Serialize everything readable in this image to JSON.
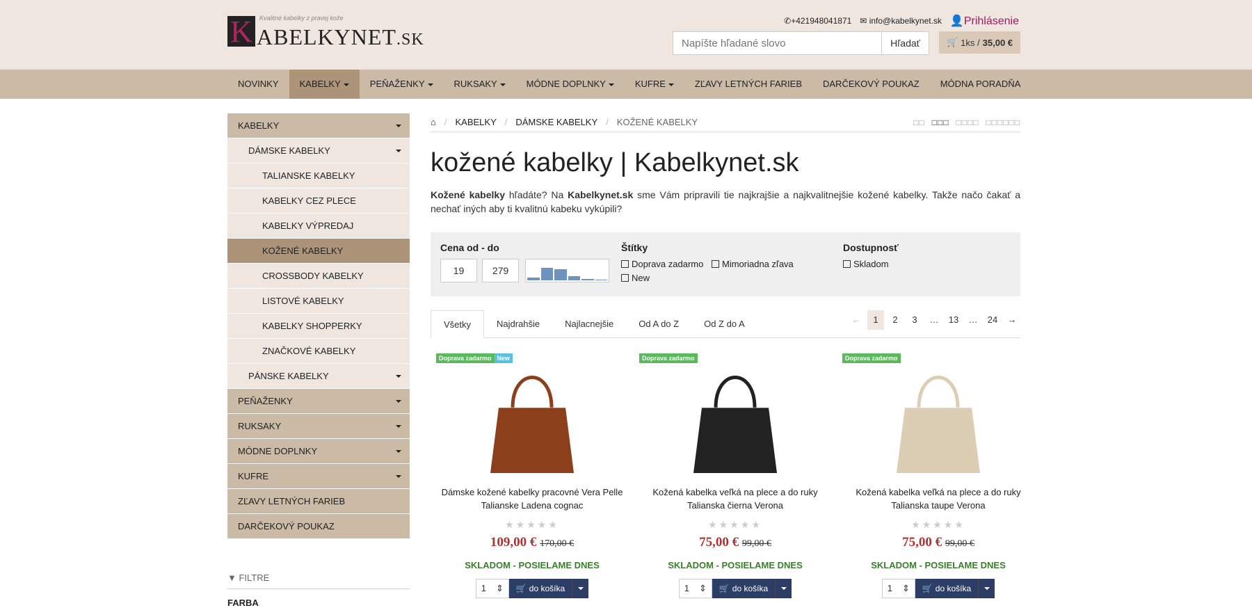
{
  "header": {
    "logo_tagline": "Kvalitné kabelky z pravej kože",
    "logo_letter": "K",
    "logo_name": "ABELKYNET",
    "logo_tld": ".SK",
    "phone": "+421948041871",
    "email": "info@kabelkynet.sk",
    "login": "Prihlásenie",
    "search_placeholder": "Napíšte hľadané slovo",
    "search_button": "Hľadať",
    "cart_count": "1ks /",
    "cart_total": "35,00 €"
  },
  "nav": [
    {
      "label": "NOVINKY",
      "caret": false
    },
    {
      "label": "KABELKY",
      "caret": true
    },
    {
      "label": "PEŇAŽENKY",
      "caret": true
    },
    {
      "label": "RUKSAKY",
      "caret": true
    },
    {
      "label": "MÓDNE DOPLNKY",
      "caret": true
    },
    {
      "label": "KUFRE",
      "caret": true
    },
    {
      "label": "ZĽAVY LETNÝCH FARIEB",
      "caret": false
    },
    {
      "label": "DARČEKOVÝ POUKAZ",
      "caret": false
    },
    {
      "label": "MÓDNA PORADŇA",
      "caret": false
    }
  ],
  "sidebar": [
    {
      "label": "KABELKY",
      "level": 0,
      "caret": true
    },
    {
      "label": "DÁMSKE KABELKY",
      "level": 1,
      "caret": true
    },
    {
      "label": "TALIANSKE KABELKY",
      "level": 2,
      "caret": false
    },
    {
      "label": "KABELKY CEZ PLECE",
      "level": 2,
      "caret": false
    },
    {
      "label": "KABELKY VÝPREDAJ",
      "level": 2,
      "caret": false
    },
    {
      "label": "KOŽENÉ KABELKY",
      "level": 2,
      "caret": false
    },
    {
      "label": "CROSSBODY KABELKY",
      "level": 2,
      "caret": false
    },
    {
      "label": "LISTOVÉ KABELKY",
      "level": 2,
      "caret": false
    },
    {
      "label": "KABELKY SHOPPERKY",
      "level": 2,
      "caret": false
    },
    {
      "label": "ZNAČKOVÉ KABELKY",
      "level": 2,
      "caret": false
    },
    {
      "label": "PÁNSKE KABELKY",
      "level": 1,
      "caret": true
    },
    {
      "label": "PEŇAŽENKY",
      "level": 0,
      "caret": true
    },
    {
      "label": "RUKSAKY",
      "level": 0,
      "caret": true
    },
    {
      "label": "MÓDNE DOPLNKY",
      "level": 0,
      "caret": true
    },
    {
      "label": "KUFRE",
      "level": 0,
      "caret": true
    },
    {
      "label": "ZĽAVY LETNÝCH FARIEB",
      "level": 0,
      "caret": false
    },
    {
      "label": "DARČEKOVÝ POUKAZ",
      "level": 0,
      "caret": false
    }
  ],
  "sidebar_filter": {
    "title": "FILTRE",
    "farba": "FARBA"
  },
  "breadcrumb": [
    "KABELKY",
    "DÁMSKE KABELKY",
    "KOŽENÉ KABELKY"
  ],
  "view_options": [
    "□□",
    "□□□",
    "□□□□",
    "□□□□□□"
  ],
  "page_title": "kožené kabelky | Kabelkynet.sk",
  "intro": {
    "bold1": "Kožené kabelky",
    "text1": " hľadáte? Na ",
    "bold2": "Kabelkynet.sk",
    "text2": " sme  Vám pripravili tie najkrajšie a najkvalitnejšie  kožené kabelky.  Takže načo čakať a nechať iných aby ti kvalitnú kabeku vykúpili?"
  },
  "filters": {
    "price_label": "Cena od - do",
    "price_from": "19",
    "price_to": "279",
    "histogram": [
      0.15,
      0.6,
      0.55,
      0.2,
      0.08,
      0.05
    ],
    "tags_label": "Štítky",
    "tags": [
      "Doprava zadarmo",
      "Mimoriadna zľava",
      "New"
    ],
    "availability_label": "Dostupnosť",
    "availability": [
      "Skladom"
    ]
  },
  "sort_tabs": [
    "Všetky",
    "Najdrahšie",
    "Najlacnejšie",
    "Od A do Z",
    "Od Z do A"
  ],
  "pager": [
    "1",
    "2",
    "3",
    "…",
    "13",
    "…",
    "24"
  ],
  "products": [
    {
      "badges": [
        "Doprava zadarmo",
        "New"
      ],
      "name": "Dámske kožené kabelky pracovné Vera Pelle Talianske Ladena cognac",
      "price": "109,00 €",
      "old_price": "170,00 €",
      "stock": "SKLADOM - POSIELAME DNES",
      "qty": "1",
      "cta": "do košíka",
      "color": "#8b3f1a"
    },
    {
      "badges": [
        "Doprava zadarmo"
      ],
      "name": "Kožená kabelka veľká na plece a do ruky Talianska čierna Verona",
      "price": "75,00 €",
      "old_price": "99,00 €",
      "stock": "SKLADOM - POSIELAME DNES",
      "qty": "1",
      "cta": "do košíka",
      "color": "#222222"
    },
    {
      "badges": [
        "Doprava zadarmo"
      ],
      "name": "Kožená kabelka veľká na plece a do ruky Talianska taupe Verona",
      "price": "75,00 €",
      "old_price": "99,00 €",
      "stock": "SKLADOM - POSIELAME DNES",
      "qty": "1",
      "cta": "do košíka",
      "color": "#dccdb5"
    }
  ],
  "colors": {
    "accent": "#9b1b5a",
    "nav": "#cbbaa5",
    "nav_active": "#ad9478",
    "header_bg": "#efe6e0",
    "button": "#2d3e66",
    "stock": "#3a7d2c",
    "price": "#aa3333"
  }
}
